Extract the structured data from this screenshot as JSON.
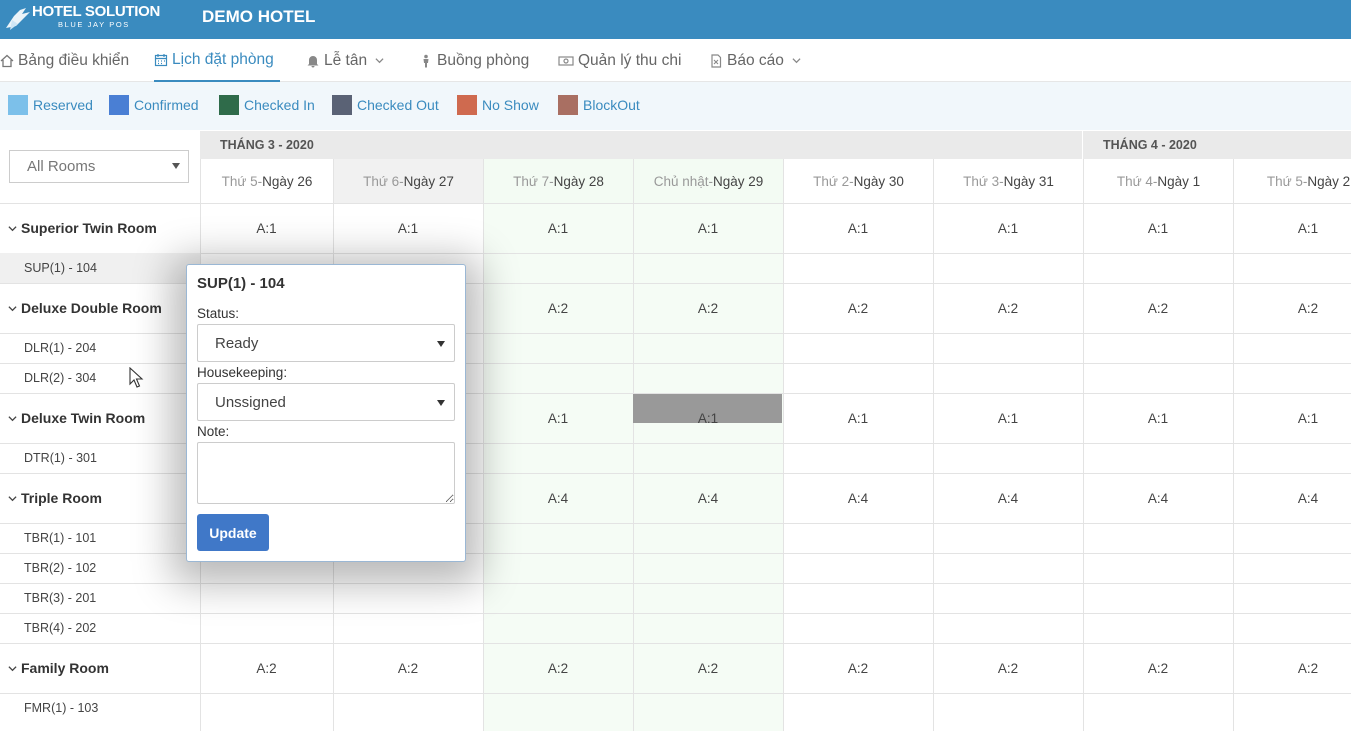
{
  "app": {
    "logo_title": "HOTEL SOLUTION",
    "logo_subtitle": "BLUE JAY POS",
    "hotel_name": "DEMO HOTEL"
  },
  "nav": [
    {
      "label": "Bảng điều khiển",
      "icon": "home-icon"
    },
    {
      "label": "Lịch đặt phòng",
      "icon": "calendar-icon",
      "active": true
    },
    {
      "label": "Lễ tân",
      "icon": "bell-icon",
      "dropdown": true
    },
    {
      "label": "Buồng phòng",
      "icon": "person-icon"
    },
    {
      "label": "Quản lý thu chi",
      "icon": "money-icon"
    },
    {
      "label": "Báo cáo",
      "icon": "report-icon",
      "dropdown": true
    }
  ],
  "legend": [
    {
      "label": "Reserved",
      "color": "#7cc0ea"
    },
    {
      "label": "Confirmed",
      "color": "#4a7fd4"
    },
    {
      "label": "Checked In",
      "color": "#2f6b4a"
    },
    {
      "label": "Checked Out",
      "color": "#5a6275"
    },
    {
      "label": "No Show",
      "color": "#cf6a4f"
    },
    {
      "label": "BlockOut",
      "color": "#a96f62"
    }
  ],
  "filter": {
    "value": "All Rooms"
  },
  "months": [
    "THÁNG 3 - 2020",
    "THÁNG 4 - 2020"
  ],
  "days": [
    {
      "dow": "Thứ 5-",
      "date": "Ngày 26"
    },
    {
      "dow": "Thứ 6-",
      "date": "Ngày 27"
    },
    {
      "dow": "Thứ 7-",
      "date": "Ngày 28"
    },
    {
      "dow": "Chủ nhật-",
      "date": "Ngày 29"
    },
    {
      "dow": "Thứ 2-",
      "date": "Ngày 30"
    },
    {
      "dow": "Thứ 3-",
      "date": "Ngày 31"
    },
    {
      "dow": "Thứ 4-",
      "date": "Ngày 1"
    },
    {
      "dow": "Thứ 5-",
      "date": "Ngày 2"
    }
  ],
  "categories": [
    {
      "name": "Superior Twin Room",
      "avail": [
        "A:1",
        "A:1",
        "A:1",
        "A:1",
        "A:1",
        "A:1",
        "A:1",
        "A:1"
      ],
      "rooms": [
        "SUP(1) - 104"
      ]
    },
    {
      "name": "Deluxe Double Room",
      "avail": [
        "",
        "",
        "A:2",
        "A:2",
        "A:2",
        "A:2",
        "A:2",
        "A:2"
      ],
      "rooms": [
        "DLR(1) - 204",
        "DLR(2) - 304"
      ]
    },
    {
      "name": "Deluxe Twin Room",
      "avail": [
        "",
        "",
        "A:1",
        "A:1",
        "A:1",
        "A:1",
        "A:1",
        "A:1"
      ],
      "rooms": [
        "DTR(1) - 301"
      ]
    },
    {
      "name": "Triple Room",
      "avail": [
        "",
        "",
        "A:4",
        "A:4",
        "A:4",
        "A:4",
        "A:4",
        "A:4"
      ],
      "rooms": [
        "TBR(1) - 101",
        "TBR(2) - 102",
        "TBR(3) - 201",
        "TBR(4) - 202"
      ]
    },
    {
      "name": "Family Room",
      "avail": [
        "A:2",
        "A:2",
        "A:2",
        "A:2",
        "A:2",
        "A:2",
        "A:2",
        "A:2"
      ],
      "rooms": [
        "FMR(1) - 103"
      ]
    }
  ],
  "popup": {
    "title": "SUP(1) - 104",
    "status_label": "Status:",
    "status_value": "Ready",
    "housekeeping_label": "Housekeeping:",
    "housekeeping_value": "Unssigned",
    "note_label": "Note:",
    "note_value": "",
    "update_label": "Update"
  }
}
